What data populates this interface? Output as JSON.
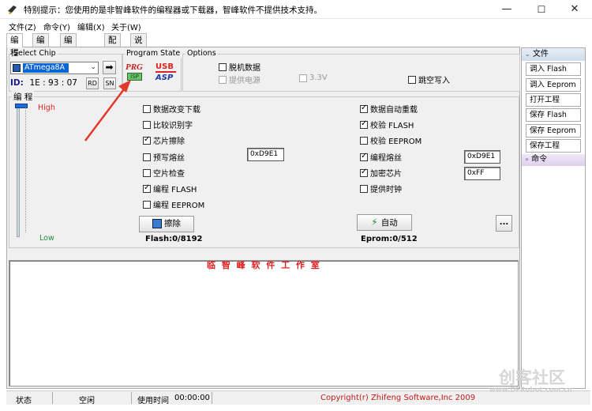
{
  "window": {
    "title": "特别提示：您使用的是非智峰软件的编程器或下载器，智峰软件不提供技术支持。",
    "minimize": "—",
    "maximize": "☐",
    "close": "✕"
  },
  "menu": [
    "文件(Z)",
    "命令(Y)",
    "编辑(X)",
    "关于(W)"
  ],
  "tabs": [
    "编 程",
    "编 辑",
    "编程器测试",
    "配 置",
    "说 明"
  ],
  "select_chip": {
    "group_label": "Select Chip",
    "chip": "ATmega8A",
    "go_icon": "➡",
    "id_label": "ID:",
    "id_value": "1E : 93 : 07",
    "rd": "RD",
    "sn": "SN"
  },
  "program_state": {
    "group_label": "Program State",
    "prg_text": "PRG",
    "usb_text": "USB",
    "isp_text": "ISP",
    "asp_text": "ASP"
  },
  "options": {
    "group_label": "Options",
    "offline": "脱机数据",
    "power": "提供电源",
    "v33": "3.3V",
    "skip_write": "跳空写入"
  },
  "program": {
    "group_label": "编 程",
    "high": "High",
    "low": "Low",
    "left_options": [
      {
        "label": "数据改变下载",
        "checked": false
      },
      {
        "label": "比较识别字",
        "checked": false
      },
      {
        "label": "芯片擦除",
        "checked": true
      },
      {
        "label": "预写熔丝",
        "checked": false
      },
      {
        "label": "空片检查",
        "checked": false
      },
      {
        "label": "编程 FLASH",
        "checked": true
      },
      {
        "label": "编程 EEPROM",
        "checked": false
      }
    ],
    "right_options": [
      {
        "label": "数据自动重载",
        "checked": true
      },
      {
        "label": "校验 FLASH",
        "checked": true
      },
      {
        "label": "校验 EEPROM",
        "checked": false
      },
      {
        "label": "编程熔丝",
        "checked": true
      },
      {
        "label": "加密芯片",
        "checked": true
      },
      {
        "label": "提供时钟",
        "checked": false
      }
    ],
    "prefuse_value": "0xD9E1",
    "fuse_value": "0xD9E1",
    "lock_value": "0xFF",
    "erase_btn": "擦除",
    "auto_btn": "自动",
    "more_btn": "...",
    "flash_info": "Flash:0/8192",
    "eprom_info": "Eprom:0/512"
  },
  "log_text": "临 智 峰 软 件 工 作 室 ",
  "right_panel": {
    "file_header": "文件",
    "buttons": [
      "调入 Flash",
      "调入 Eeprom",
      "打开工程",
      "保存 Flash",
      "保存 Eeprom",
      "保存工程"
    ],
    "cmd_header": "命令"
  },
  "status": {
    "label": "状态",
    "state": "空闲",
    "time_label": "使用时间",
    "time": "00:00:00",
    "copyright": "Copyright(r) Zhifeng Software,Inc 2009"
  },
  "watermark": {
    "big": "创客社区",
    "url": "www.DFRobot.com.cn"
  },
  "colors": {
    "accent_red": "#e01e1e",
    "title_blue": "#1a1a8c"
  }
}
